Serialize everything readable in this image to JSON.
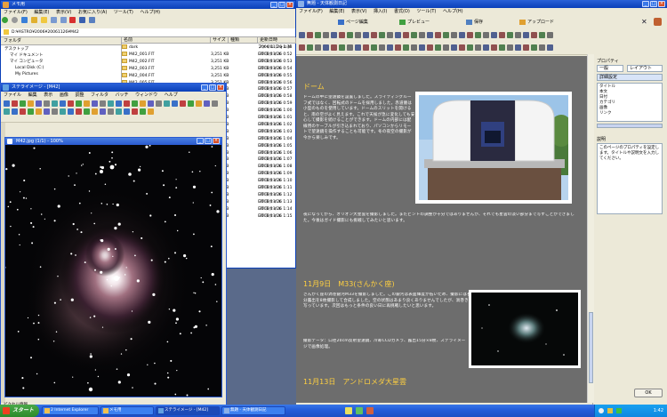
{
  "explorer": {
    "title": "メモ用",
    "menu": [
      "ファイル(F)",
      "編集(E)",
      "表示(V)",
      "お気に入り(A)",
      "ツール(T)",
      "ヘルプ(H)"
    ],
    "address": "D:¥ASTRO¥2006¥20061126¥M42",
    "folders_label": "フォルダ",
    "tree": [
      "デスクトップ",
      "マイ ドキュメント",
      "マイ コンピュータ",
      "Local Disk (C:)",
      "My Pictures"
    ],
    "columns": [
      "名前",
      "サイズ",
      "種類",
      "更新日時"
    ],
    "files": [
      {
        "name": "dark",
        "size": "",
        "type": "ファイル フォルダ",
        "date": "2006/11/26 1:38"
      },
      {
        "name": "M42_001.FIT",
        "size": "3,251 KB",
        "type": "FIT ファイル",
        "date": "2006/11/26 0:52"
      },
      {
        "name": "M42_002.FIT",
        "size": "3,251 KB",
        "type": "FIT ファイル",
        "date": "2006/11/26 0:53"
      },
      {
        "name": "M42_003.FIT",
        "size": "3,251 KB",
        "type": "FIT ファイル",
        "date": "2006/11/26 0:54"
      },
      {
        "name": "M42_004.FIT",
        "size": "3,251 KB",
        "type": "FIT ファイル",
        "date": "2006/11/26 0:55"
      },
      {
        "name": "M42_005.FIT",
        "size": "3,251 KB",
        "type": "FIT ファイル",
        "date": "2006/11/26 0:56"
      },
      {
        "name": "M42_006.FIT",
        "size": "3,251 KB",
        "type": "FIT ファイル",
        "date": "2006/11/26 0:57"
      },
      {
        "name": "M42_007.FIT",
        "size": "3,251 KB",
        "type": "FIT ファイル",
        "date": "2006/11/26 0:58"
      },
      {
        "name": "M42_008.FIT",
        "size": "3,251 KB",
        "type": "FIT ファイル",
        "date": "2006/11/26 0:59"
      },
      {
        "name": "M42_009.FIT",
        "size": "3,251 KB",
        "type": "FIT ファイル",
        "date": "2006/11/26 1:00"
      },
      {
        "name": "M42_010.FIT",
        "size": "3,251 KB",
        "type": "FIT ファイル",
        "date": "2006/11/26 1:01"
      },
      {
        "name": "M42_011.FIT",
        "size": "3,251 KB",
        "type": "FIT ファイル",
        "date": "2006/11/26 1:02"
      },
      {
        "name": "M42_012.FIT",
        "size": "3,251 KB",
        "type": "FIT ファイル",
        "date": "2006/11/26 1:03"
      },
      {
        "name": "M42_013.FIT",
        "size": "3,251 KB",
        "type": "FIT ファイル",
        "date": "2006/11/26 1:04"
      },
      {
        "name": "M42_014.FIT",
        "size": "3,251 KB",
        "type": "FIT ファイル",
        "date": "2006/11/26 1:05"
      },
      {
        "name": "M42_015.FIT",
        "size": "3,251 KB",
        "type": "FIT ファイル",
        "date": "2006/11/26 1:06"
      },
      {
        "name": "M42_016.FIT",
        "size": "3,251 KB",
        "type": "FIT ファイル",
        "date": "2006/11/26 1:07"
      },
      {
        "name": "M42_017.FIT",
        "size": "3,251 KB",
        "type": "FIT ファイル",
        "date": "2006/11/26 1:08"
      },
      {
        "name": "M42_018.FIT",
        "size": "3,251 KB",
        "type": "FIT ファイル",
        "date": "2006/11/26 1:09"
      },
      {
        "name": "M42_019.FIT",
        "size": "3,251 KB",
        "type": "FIT ファイル",
        "date": "2006/11/26 1:10"
      },
      {
        "name": "M42_020.FIT",
        "size": "3,251 KB",
        "type": "FIT ファイル",
        "date": "2006/11/26 1:11"
      },
      {
        "name": "M42_021.FIT",
        "size": "3,251 KB",
        "type": "FIT ファイル",
        "date": "2006/11/26 1:12"
      },
      {
        "name": "M42_022.FIT",
        "size": "3,251 KB",
        "type": "FIT ファイル",
        "date": "2006/11/26 1:13"
      },
      {
        "name": "M42_023.FIT",
        "size": "3,251 KB",
        "type": "FIT ファイル",
        "date": "2006/11/26 1:14"
      },
      {
        "name": "M42_024.FIT",
        "size": "3,251 KB",
        "type": "FIT ファイル",
        "date": "2006/11/26 1:15"
      }
    ]
  },
  "editor": {
    "title": "ステライメージ - [M42]",
    "menu": [
      "ファイル",
      "編集",
      "表示",
      "画像",
      "調整",
      "フィルタ",
      "バッチ",
      "ウィンドウ",
      "ヘルプ"
    ],
    "image_title": "M42.jpg (1/1) - 100%",
    "status": "ピクセル情報"
  },
  "blog": {
    "title": "無題 - 天体観測日記",
    "menu": [
      "ファイル(F)",
      "編集(E)",
      "表示(V)",
      "挿入(I)",
      "書式(O)",
      "ツール(T)",
      "ヘルプ(H)"
    ],
    "toolbar_labels": [
      "ページ編集",
      "プレビュー",
      "保存",
      "アップロード"
    ],
    "heading1": "ドーム",
    "paragraph1": "ドームの中に望遠鏡を設置しました。スライディングルーフ式ではなく、回転式のドームを採用しました。赤道儀は小型のものを使用しています。ドームのスリットを開けると、南の空がよく見えます。これで天候が急に変化しても安心して撮影を続けることができます。ドームの内部には配線用のケーブルが引き込まれており、パソコンからリモートで望遠鏡を操作することも可能です。冬の夜空の撮影が今から楽しみです。",
    "paragraph1b": "夜になってから、オリオン大星雲を撮影しました。まだピントの調整が十分ではありませんが、それでも星雲の淡い部分まで写すことができました。今後はガイド撮影にも挑戦してみたいと思います。",
    "heading2": "11月9日　M33(さんかく座)",
    "paragraph2": "さんかく座の渦巻銀河M33を撮影しました。この銀河は表面輝度が低いため、撮影には長時間の露出が必要です。今回は15分露出を8枚撮影して合成しました。空の状態はあまり良くありませんでしたが、渦巻きの腕の構造がなんとか分かる程度に写っています。次回はもっと条件の良い日に再挑戦したいと思います。",
    "paragraph2b": "撮影データ：口径20cm反射望遠鏡、冷却CCDカメラ、露出15分×8枚、ステライメージで画像処理。",
    "heading3": "11月13日　アンドロメダ大星雲",
    "right_panel": {
      "title": "プロパティ",
      "tab1": "一般",
      "tab2": "レイアウト",
      "tab3": "詳細設定",
      "items": [
        "タイトル",
        "本文",
        "日付",
        "カテゴリ",
        "画像",
        "リンク",
        "コメント"
      ],
      "section": "説明",
      "desc": "このページのプロパティを設定します。タイトルや説明文を入力してください。"
    },
    "footer_button": "OK"
  },
  "taskbar": {
    "start": "スタート",
    "buttons": [
      "2 Internet Explorer",
      "メモ用",
      "ステライメージ - [M42]",
      "無題 - 天体観測日記"
    ],
    "clock": "1:42"
  },
  "colors": {
    "blog_bg": "#6d6d6d",
    "heading": "#ffd040",
    "taskbar": "#245edb",
    "titlebar": "#0a3fb8"
  }
}
